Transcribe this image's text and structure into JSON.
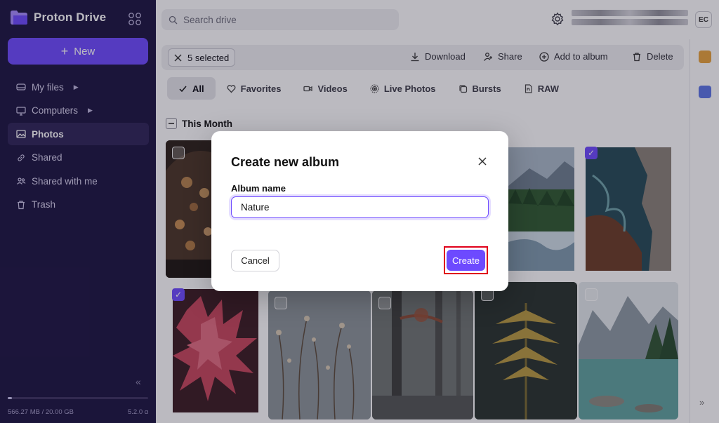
{
  "app": {
    "name": "Proton Drive"
  },
  "sidebar": {
    "new_label": "New",
    "items": [
      {
        "label": "My files",
        "has_caret": true
      },
      {
        "label": "Computers",
        "has_caret": true
      },
      {
        "label": "Photos",
        "active": true
      },
      {
        "label": "Shared"
      },
      {
        "label": "Shared with me"
      },
      {
        "label": "Trash"
      }
    ],
    "storage": {
      "text": "566.27 MB / 20.00 GB",
      "used_fraction": 0.028
    },
    "version": "5.2.0 α"
  },
  "header": {
    "search_placeholder": "Search drive",
    "avatar_initials": "EC"
  },
  "toolbar": {
    "selected_label": "5 selected",
    "actions": [
      "Download",
      "Share",
      "Add to album",
      "Delete"
    ]
  },
  "filters": [
    "All",
    "Favorites",
    "Videos",
    "Live Photos",
    "Bursts",
    "RAW"
  ],
  "section": {
    "title": "This Month"
  },
  "dialog": {
    "title": "Create new album",
    "field_label": "Album name",
    "field_value": "Nature",
    "cancel_label": "Cancel",
    "create_label": "Create"
  },
  "colors": {
    "accent": "#6d4aff",
    "sidebar_bg": "#1b1340",
    "highlight": "#e0001b"
  }
}
